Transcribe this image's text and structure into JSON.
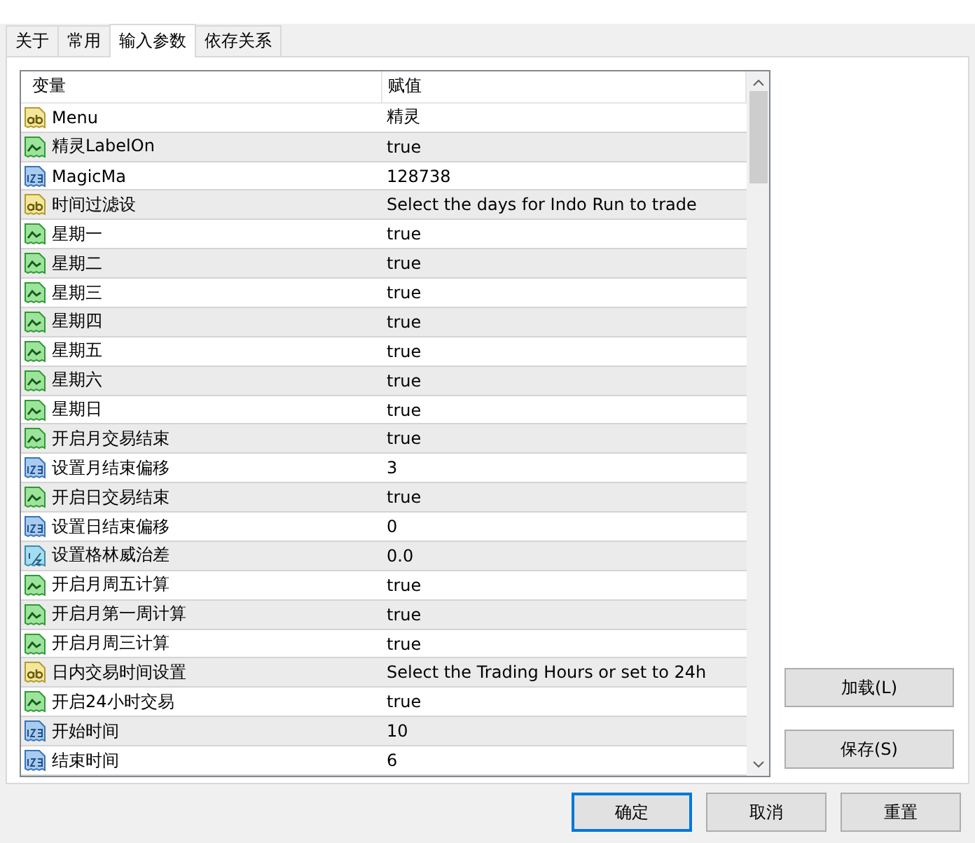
{
  "tabs": [
    {
      "label": "关于",
      "selected": false
    },
    {
      "label": "常用",
      "selected": false
    },
    {
      "label": "输入参数",
      "selected": true
    },
    {
      "label": "依存关系",
      "selected": false
    }
  ],
  "table": {
    "columns": [
      "变量",
      "赋值"
    ],
    "rows": [
      {
        "kind": "string",
        "name": "Menu",
        "value": "精灵"
      },
      {
        "kind": "bool",
        "name": "精灵LabelOn",
        "value": "true"
      },
      {
        "kind": "int",
        "name": "MagicMa",
        "value": "128738"
      },
      {
        "kind": "string",
        "name": "时间过滤设",
        "value": "Select the days for Indo Run to trade"
      },
      {
        "kind": "bool",
        "name": "星期一",
        "value": "true"
      },
      {
        "kind": "bool",
        "name": "星期二",
        "value": "true"
      },
      {
        "kind": "bool",
        "name": "星期三",
        "value": "true"
      },
      {
        "kind": "bool",
        "name": "星期四",
        "value": "true"
      },
      {
        "kind": "bool",
        "name": "星期五",
        "value": "true"
      },
      {
        "kind": "bool",
        "name": "星期六",
        "value": "true"
      },
      {
        "kind": "bool",
        "name": "星期日",
        "value": "true"
      },
      {
        "kind": "bool",
        "name": "开启月交易结束",
        "value": "true"
      },
      {
        "kind": "int",
        "name": "设置月结束偏移",
        "value": "3"
      },
      {
        "kind": "bool",
        "name": "开启日交易结束",
        "value": "true"
      },
      {
        "kind": "int",
        "name": "设置日结束偏移",
        "value": "0"
      },
      {
        "kind": "double",
        "name": "设置格林威治差",
        "value": "0.0"
      },
      {
        "kind": "bool",
        "name": "开启月周五计算",
        "value": "true"
      },
      {
        "kind": "bool",
        "name": "开启月第一周计算",
        "value": "true"
      },
      {
        "kind": "bool",
        "name": "开启月周三计算",
        "value": "true"
      },
      {
        "kind": "string",
        "name": "日内交易时间设置",
        "value": "Select the Trading Hours or set to 24h"
      },
      {
        "kind": "bool",
        "name": "开启24小时交易",
        "value": "true"
      },
      {
        "kind": "int",
        "name": "开始时间",
        "value": "10"
      },
      {
        "kind": "int",
        "name": "结束时间",
        "value": "6"
      }
    ]
  },
  "side_buttons": [
    "加载(L)",
    "保存(S)"
  ],
  "bottom_buttons": [
    {
      "label": "确定",
      "selected": true
    },
    {
      "label": "取消",
      "selected": false
    },
    {
      "label": "重置",
      "selected": false
    }
  ]
}
